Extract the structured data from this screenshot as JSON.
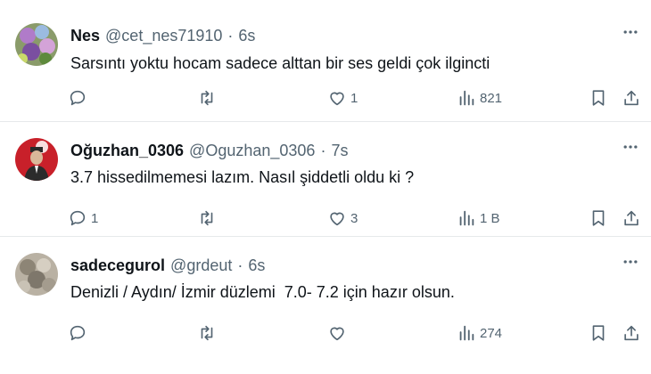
{
  "tweets": [
    {
      "name": "Nes",
      "handle": "@cet_nes71910",
      "dot": "·",
      "time": "6s",
      "text": "Sarsıntı yoktu hocam sadece alttan bir ses geldi çok ilgincti",
      "replies": "",
      "retweets": "",
      "likes": "1",
      "views": "821"
    },
    {
      "name": "Oğuzhan_0306",
      "handle": "@Oguzhan_0306",
      "dot": "·",
      "time": "7s",
      "text": "3.7 hissedilmemesi lazım. Nasıl şiddetli oldu ki ?",
      "replies": "1",
      "retweets": "",
      "likes": "3",
      "views": "1 B"
    },
    {
      "name": "sadecegurol",
      "handle": "@grdeut",
      "dot": "·",
      "time": "6s",
      "text": "Denizli / Aydın/ İzmir düzlemi  7.0- 7.2 için hazır olsun.",
      "replies": "",
      "retweets": "",
      "likes": "",
      "views": "274"
    }
  ],
  "colors": {
    "text": "#0f1419",
    "muted": "#536471",
    "divider": "#e6e9eb"
  },
  "icons": [
    "reply-icon",
    "retweet-icon",
    "like-icon",
    "views-icon",
    "bookmark-icon",
    "share-icon",
    "more-icon"
  ]
}
